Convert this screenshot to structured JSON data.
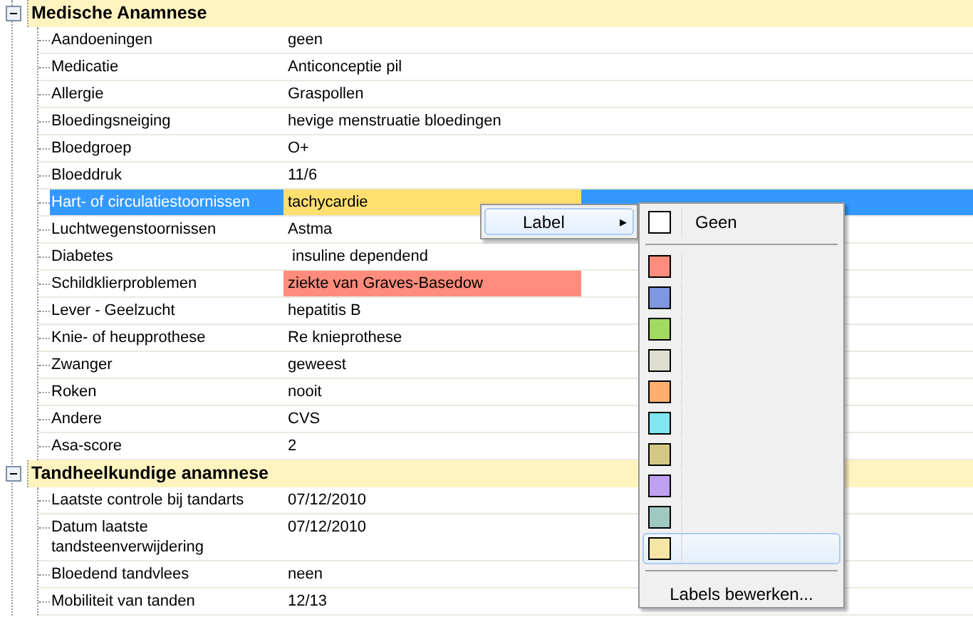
{
  "groups": [
    {
      "title": "Medische Anamnese",
      "expanded": true,
      "rows": [
        {
          "label": "Aandoeningen",
          "value": "geen",
          "selected": false
        },
        {
          "label": "Medicatie",
          "value": "Anticonceptie pil",
          "selected": false
        },
        {
          "label": "Allergie",
          "value": "Graspollen",
          "selected": false
        },
        {
          "label": "Bloedingsneiging",
          "value": "hevige menstruatie bloedingen",
          "selected": false
        },
        {
          "label": "Bloedgroep",
          "value": "O+",
          "selected": false
        },
        {
          "label": "Bloeddruk",
          "value": "11/6",
          "selected": false
        },
        {
          "label": "Hart- of circulatiestoornissen",
          "value": "tachycardie",
          "selected": true,
          "color": "#ffdf70"
        },
        {
          "label": "Luchtwegenstoornissen",
          "value": "Astma",
          "selected": false
        },
        {
          "label": "Diabetes",
          "value": " insuline dependend",
          "selected": false
        },
        {
          "label": "Schildklierproblemen",
          "value": "ziekte van Graves-Basedow",
          "selected": false,
          "color": "#ff8c7c"
        },
        {
          "label": "Lever - Geelzucht",
          "value": "hepatitis B",
          "selected": false
        },
        {
          "label": "Knie- of heupprothese",
          "value": "Re knieprothese",
          "selected": false
        },
        {
          "label": "Zwanger",
          "value": "geweest",
          "selected": false
        },
        {
          "label": "Roken",
          "value": "nooit",
          "selected": false
        },
        {
          "label": "Andere",
          "value": "CVS",
          "selected": false
        },
        {
          "label": "Asa-score",
          "value": "2",
          "selected": false
        }
      ]
    },
    {
      "title": "Tandheelkundige anamnese",
      "expanded": true,
      "rows": [
        {
          "label": "Laatste controle bij tandarts",
          "value": "07/12/2010",
          "selected": false
        },
        {
          "label": "Datum laatste tandsteenverwijdering",
          "value": "07/12/2010",
          "selected": false
        },
        {
          "label": "Bloedend tandvlees",
          "value": "neen",
          "selected": false
        },
        {
          "label": "Mobiliteit van tanden",
          "value": "12/13",
          "selected": false
        }
      ]
    }
  ],
  "context_menu": {
    "items": [
      {
        "label": "Label",
        "arrow": "▸"
      }
    ]
  },
  "label_menu": {
    "none": {
      "label": "Geen",
      "color": "#ffffff"
    },
    "swatches": [
      {
        "color": "#ff8c7c",
        "highlighted": false
      },
      {
        "color": "#7f96e0",
        "highlighted": false
      },
      {
        "color": "#a2d960",
        "highlighted": false
      },
      {
        "color": "#dfdfd0",
        "highlighted": false
      },
      {
        "color": "#ffae70",
        "highlighted": false
      },
      {
        "color": "#7fe6f2",
        "highlighted": false
      },
      {
        "color": "#d2c883",
        "highlighted": false
      },
      {
        "color": "#c0a0f0",
        "highlighted": false
      },
      {
        "color": "#9fc8c0",
        "highlighted": false
      },
      {
        "color": "#f5e6a5",
        "highlighted": true
      }
    ],
    "edit": "Labels bewerken..."
  }
}
